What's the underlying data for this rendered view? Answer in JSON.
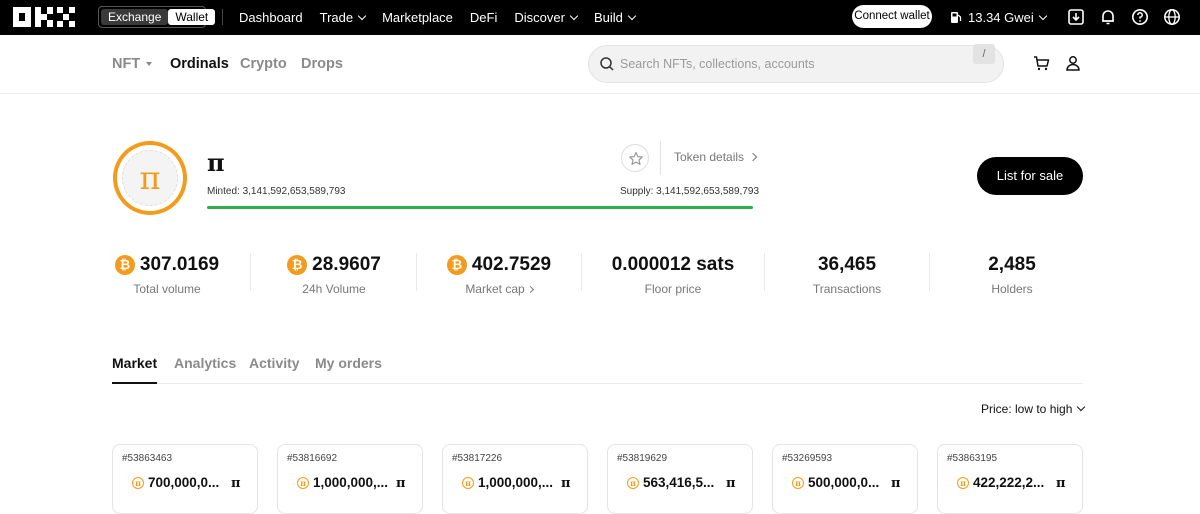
{
  "topbar": {
    "logo": "OKX",
    "segment": [
      "Exchange",
      "Wallet"
    ],
    "nav": [
      "Dashboard",
      "Trade",
      "Marketplace",
      "DeFi",
      "Discover",
      "Build"
    ],
    "connect_label": "Connect wallet",
    "gas": "13.34 Gwei",
    "icons": [
      "download-icon",
      "bell-icon",
      "help-icon",
      "globe-icon"
    ]
  },
  "subnav": {
    "tabs": [
      "NFT",
      "Ordinals",
      "Crypto",
      "Drops"
    ],
    "search_placeholder": "Search NFTs, collections, accounts",
    "shortcut": "/"
  },
  "collection": {
    "name": "π",
    "avatar_symbol": "π",
    "minted": "Minted: 3,141,592,653,589,793",
    "supply": "Supply: 3,141,592,653,589,793",
    "minted_fraction": 1.0,
    "token_details": "Token details",
    "list_label": "List for sale"
  },
  "stats": [
    {
      "value": "307.0169",
      "label": "Total volume"
    },
    {
      "value": "28.9607",
      "label": "24h Volume"
    },
    {
      "value": "402.7529",
      "label": "Market cap"
    },
    {
      "value": "0.000012 sats",
      "label": "Floor price"
    },
    {
      "value": "36,465",
      "label": "Transactions"
    },
    {
      "value": "2,485",
      "label": "Holders"
    }
  ],
  "tabs": [
    "Market",
    "Analytics",
    "Activity",
    "My orders"
  ],
  "sort_label": "Price: low to high",
  "cards": [
    {
      "id": "#53863463",
      "amount": "700,000,0...",
      "ticker": "π"
    },
    {
      "id": "#53816692",
      "amount": "1,000,000,...",
      "ticker": "π"
    },
    {
      "id": "#53817226",
      "amount": "1,000,000,...",
      "ticker": "π"
    },
    {
      "id": "#53819629",
      "amount": "563,416,5...",
      "ticker": "π"
    },
    {
      "id": "#53269593",
      "amount": "500,000,0...",
      "ticker": "π"
    },
    {
      "id": "#53863195",
      "amount": "422,222,2...",
      "ticker": "π"
    }
  ],
  "colors": {
    "accent": "#f39b1d",
    "progress": "#2fae4e"
  }
}
